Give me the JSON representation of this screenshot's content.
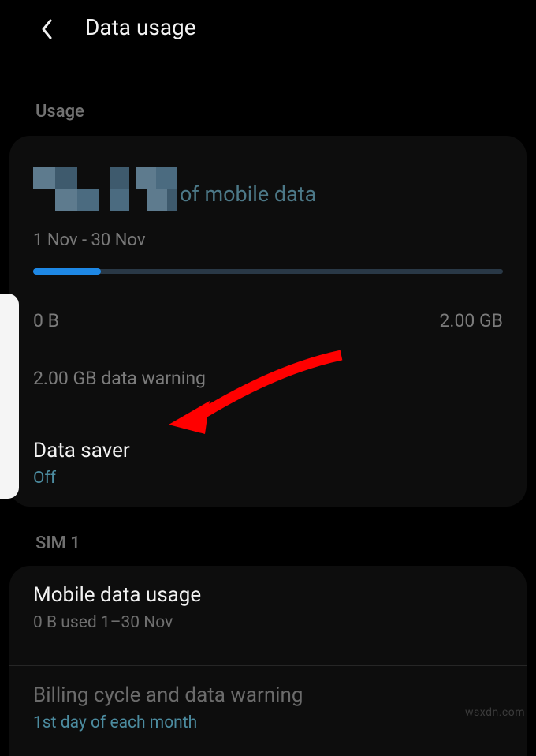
{
  "header": {
    "title": "Data usage"
  },
  "usage_section": {
    "header": "Usage",
    "of_label": "of mobile data",
    "date_range": "1 Nov - 30 Nov",
    "min_label": "0 B",
    "max_label": "2.00 GB",
    "warning": "2.00 GB data warning",
    "progress_percent": 14.5
  },
  "data_saver": {
    "title": "Data saver",
    "status": "Off"
  },
  "sim_section": {
    "header": "SIM 1",
    "mobile_data": {
      "title": "Mobile data usage",
      "sub": "0 B used 1–30 Nov"
    },
    "billing": {
      "title": "Billing cycle and data warning",
      "sub": "1st day of each month"
    }
  },
  "watermark": "wsxdn.com"
}
